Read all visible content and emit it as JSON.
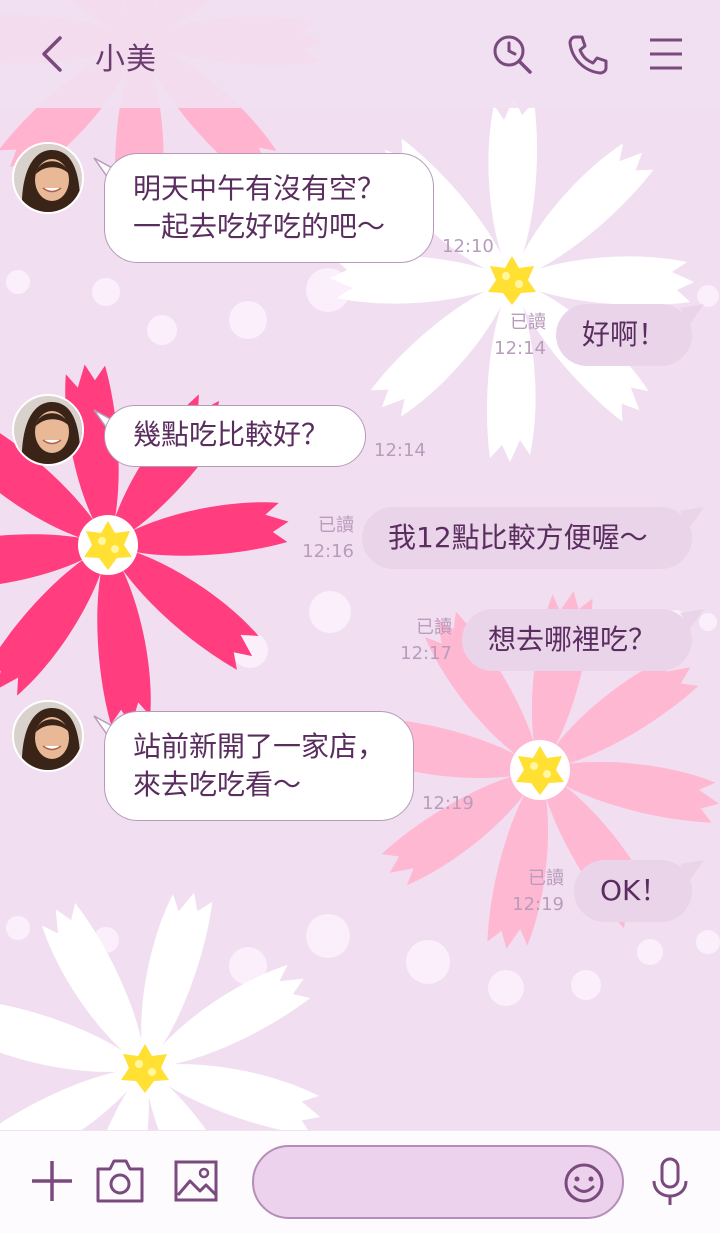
{
  "header": {
    "title": "小美",
    "icons": [
      "chevron-left-icon",
      "search-clock-icon",
      "phone-icon",
      "menu-icon"
    ]
  },
  "messages": [
    {
      "sender": "小美",
      "direction": "in",
      "text": "明天中午有沒有空？\n一起去吃好吃的吧〜",
      "time": "12:10"
    },
    {
      "direction": "out",
      "text": "好啊！",
      "read": "已讀",
      "time": "12:14"
    },
    {
      "sender": "小美",
      "direction": "in",
      "text": "幾點吃比較好？",
      "time": "12:14"
    },
    {
      "direction": "out",
      "text": "我12點比較方便喔〜",
      "read": "已讀",
      "time": "12:16"
    },
    {
      "direction": "out",
      "text": "想去哪裡吃？",
      "read": "已讀",
      "time": "12:17"
    },
    {
      "sender": "小美",
      "direction": "in",
      "text": "站前新開了一家店，\n來去吃吃看〜",
      "time": "12:19"
    },
    {
      "direction": "out",
      "text": "OK！",
      "read": "已讀",
      "time": "12:19"
    }
  ],
  "footer": {
    "icons": [
      "plus-icon",
      "camera-icon",
      "image-icon",
      "smiley-icon",
      "microphone-icon"
    ],
    "input_value": "",
    "input_placeholder": ""
  },
  "theme": {
    "background": "#f1dff1",
    "accent": "#7a4a7e",
    "flower_pink": "#ff3d7f",
    "flower_light_pink": "#ffb3cf",
    "flower_center": "#ffe033"
  }
}
